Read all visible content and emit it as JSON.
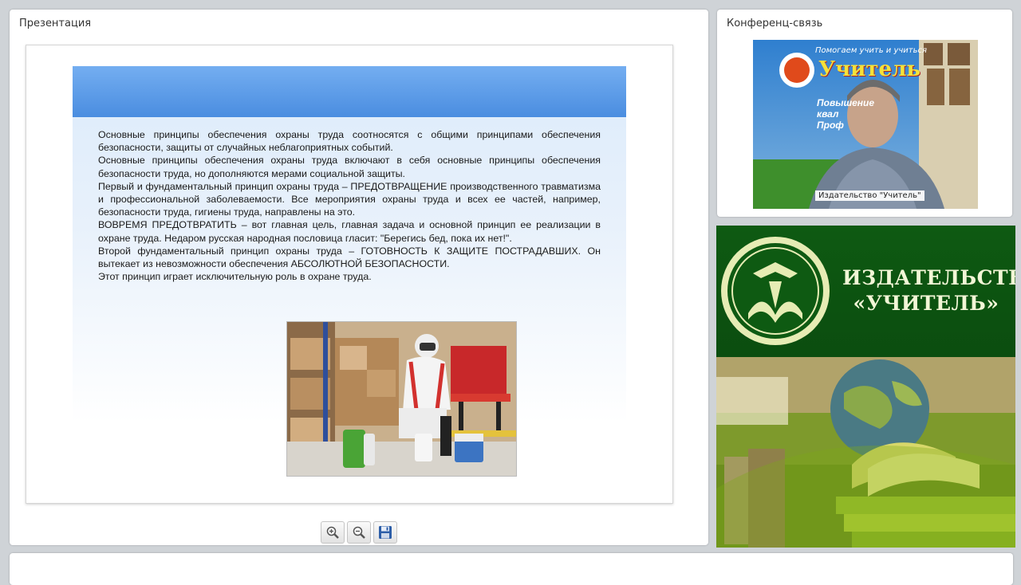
{
  "presentation": {
    "title": "Презентация",
    "slide": {
      "paragraphs": [
        "Основные принципы обеспечения охраны труда соотносятся с общими принципами обеспечения безопасности, защиты от случайных неблагоприятных событий.",
        "Основные принципы обеспечения охраны труда включают в себя основные принципы обеспечения безопасности труда, но дополняются мерами социальной защиты.",
        "Первый и фундаментальный принцип охраны труда – ПРЕДОТВРАЩЕНИЕ производственного травматизма и профессиональной заболеваемости. Все мероприятия охраны труда и всех ее частей, например, безопасности труда, гигиены труда, направлены на это.",
        "ВОВРЕМЯ ПРЕДОТВРАТИТЬ – вот главная цель, главная задача и основной принцип ее реализации в охране труда. Недаром русская народная пословица гласит: \"Берегись бед, пока их нет!\".",
        "Второй фундаментальный принцип охраны труда – ГОТОВНОСТЬ К ЗАЩИТЕ ПОСТРАДАВШИХ. Он вытекает из невозможности обеспечения АБСОЛЮТНОЙ БЕЗОПАСНОСТИ.",
        "Этот принцип играет исключительную роль в охране труда."
      ],
      "band_color": "#5b9be6"
    },
    "toolbar": {
      "zoom_in_icon": "zoom-in-icon",
      "zoom_out_icon": "zoom-out-icon",
      "save_icon": "floppy-disk-icon"
    }
  },
  "conference": {
    "title": "Конференц-связь",
    "caption": "Издательство \"Учитель\"",
    "banner_line1": "Помогаем учить и учиться",
    "banner_brand": "Учитель",
    "banner_item1": "Повышение",
    "banner_item2": "квал",
    "banner_item3": "Проф"
  },
  "publisher": {
    "name_line1": "ИЗДАТЕЛЬСТВО",
    "name_line2": "«УЧИТЕЛЬ»",
    "brand_color": "#0e5a12"
  }
}
